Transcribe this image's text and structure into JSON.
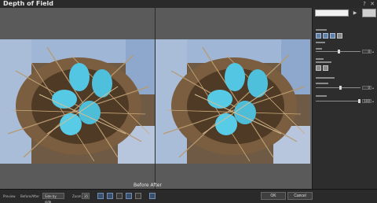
{
  "window": {
    "title": "Depth of Field",
    "help_glyph": "?",
    "close_glyph": "✕"
  },
  "workspace": {
    "caption": "Before After"
  },
  "panel": {
    "nav_arrow": "▶",
    "blur_value": "0",
    "fade_value": "0",
    "focus_value": "100",
    "spin_glyph": "▴"
  },
  "bottombar": {
    "preview_label": "Preview",
    "compare_label": "Before/After",
    "compare_select": "Side by side",
    "zoom_label": "Zoom",
    "zoom_value": "35",
    "ok_label": "OK",
    "cancel_label": "Cancel"
  },
  "colors": {
    "workspace": "#5a5a5a",
    "panel": "#2d2d2d",
    "egg": "#52c6e2",
    "nest": "#6b5236"
  }
}
